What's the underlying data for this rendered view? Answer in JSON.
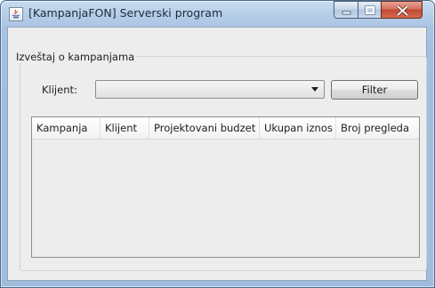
{
  "window": {
    "title": "[KampanjaFON] Serverski program"
  },
  "report_group": {
    "legend": "Izveštaj o kampanjama"
  },
  "filter_bar": {
    "client_label": "Klijent:",
    "client_combo_value": "",
    "filter_button_label": "Filter"
  },
  "table": {
    "columns": [
      "Kampanja",
      "Klijent",
      "Projektovani budzet",
      "Ukupan iznos",
      "Broj pregleda"
    ],
    "rows": []
  }
}
